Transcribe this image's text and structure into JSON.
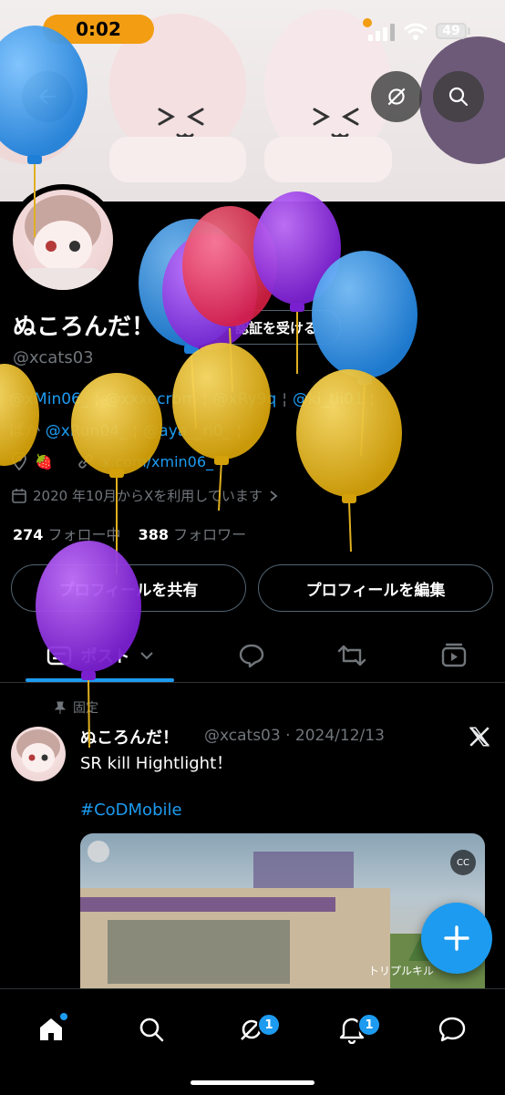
{
  "status_bar": {
    "time": "0:02",
    "battery": "49"
  },
  "profile": {
    "display_name": "ぬころんだ！",
    "handle": "@xcats03",
    "verify_label": "認証を受ける",
    "bio_line1": [
      "@xMin06_",
      "@xxxecrbm",
      "@xRy9q",
      "@ki_tii01"
    ],
    "bio_line2_prefix": "ぱか",
    "bio_line2": [
      "@xRun04_",
      "@aya__ri0_"
    ],
    "location": "🍓",
    "website": "x.com/xmin06_",
    "joined": "2020 年10月からXを利用しています",
    "following_count": "274",
    "following_label": "フォロー中",
    "followers_count": "388",
    "followers_label": "フォロワー"
  },
  "actions": {
    "share_label": "プロフィールを共有",
    "edit_label": "プロフィールを編集"
  },
  "tabs": {
    "posts_label": "ポスト"
  },
  "post": {
    "pinned_label": "固定",
    "author_name": "ぬころんだ！",
    "author_handle": "@xcats03",
    "date": "2024/12/13",
    "text": "SR kill Hightlight！",
    "hashtag": "#CoDMobile",
    "cc": "CC",
    "media_caption": "トリプルキル"
  },
  "badges": {
    "spaces": "1",
    "notifications": "1"
  },
  "colors": {
    "accent": "#1d9bf0",
    "background": "#000000",
    "status_pill": "#f29d12"
  },
  "icons": [
    "back-arrow-icon",
    "grok-icon",
    "search-icon",
    "location-icon",
    "link-icon",
    "calendar-icon",
    "posts-tab-icon",
    "reply-tab-icon",
    "repost-tab-icon",
    "video-tab-icon",
    "pin-icon",
    "x-logo-icon",
    "home-icon",
    "explore-icon",
    "grok-nav-icon",
    "notifications-icon",
    "messages-icon",
    "compose-plus-icon"
  ]
}
